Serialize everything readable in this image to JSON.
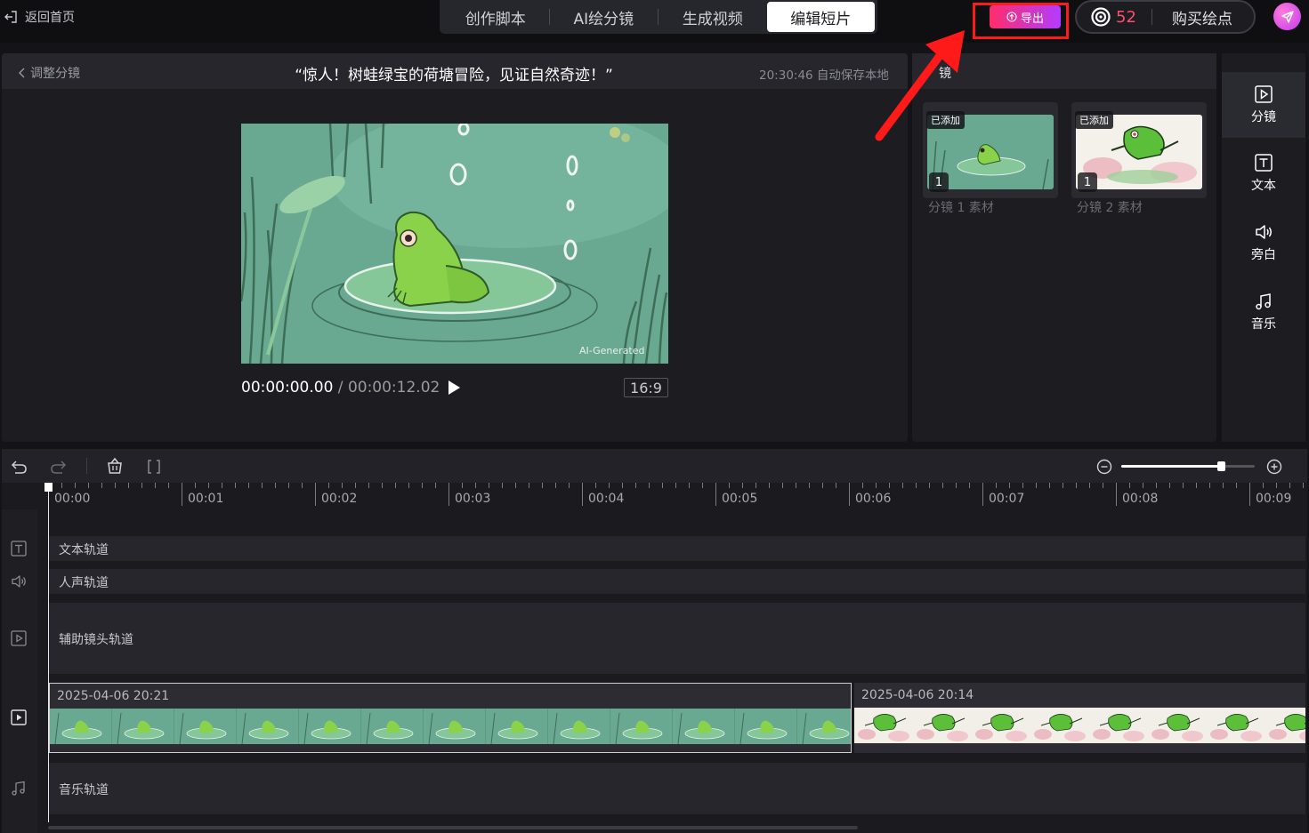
{
  "topbar": {
    "back_label": "返回首页",
    "tabs": [
      {
        "label": "创作脚本"
      },
      {
        "label": "AI绘分镜"
      },
      {
        "label": "生成视频"
      },
      {
        "label": "编辑短片",
        "active": true
      }
    ],
    "export_label": "导出",
    "points_count": "52",
    "buy_points_label": "购买绘点"
  },
  "preview": {
    "back_label": "调整分镜",
    "title": "“惊人！树蛙绿宝的荷塘冒险，见证自然奇迹！”",
    "autosave": "20:30:46 自动保存本地",
    "watermark": "AI-Generated",
    "current_time": "00:00:00.00",
    "separator": " / ",
    "total_time": "00:00:12.02",
    "ratio": "16:9"
  },
  "storyboard": {
    "header": "镜",
    "items": [
      {
        "tag": "已添加",
        "number": "1",
        "label": "分镜 1 素材"
      },
      {
        "tag": "已添加",
        "number": "1",
        "label": "分镜 2 素材"
      }
    ]
  },
  "sidebar": {
    "items": [
      {
        "label": "分镜",
        "icon": "play-square-icon",
        "active": true
      },
      {
        "label": "文本",
        "icon": "text-icon"
      },
      {
        "label": "旁白",
        "icon": "speaker-icon"
      },
      {
        "label": "音乐",
        "icon": "music-note-icon"
      }
    ]
  },
  "timeline": {
    "ticks": [
      "00:00",
      "00:01",
      "00:02",
      "00:03",
      "00:04",
      "00:05",
      "00:06",
      "00:07",
      "00:08",
      "00:09"
    ],
    "tracks": {
      "text": "文本轨道",
      "voice": "人声轨道",
      "aux": "辅助镜头轨道",
      "music": "音乐轨道"
    },
    "clips": [
      {
        "date": "2025-04-06 20:21"
      },
      {
        "date": "2025-04-06 20:14"
      }
    ],
    "zoom_level": 0.75
  },
  "colors": {
    "accent_export_start": "#ff2d6a",
    "accent_export_end": "#b23cff",
    "points_color": "#ff4c6f",
    "annotation_red": "#ff1a1a"
  }
}
